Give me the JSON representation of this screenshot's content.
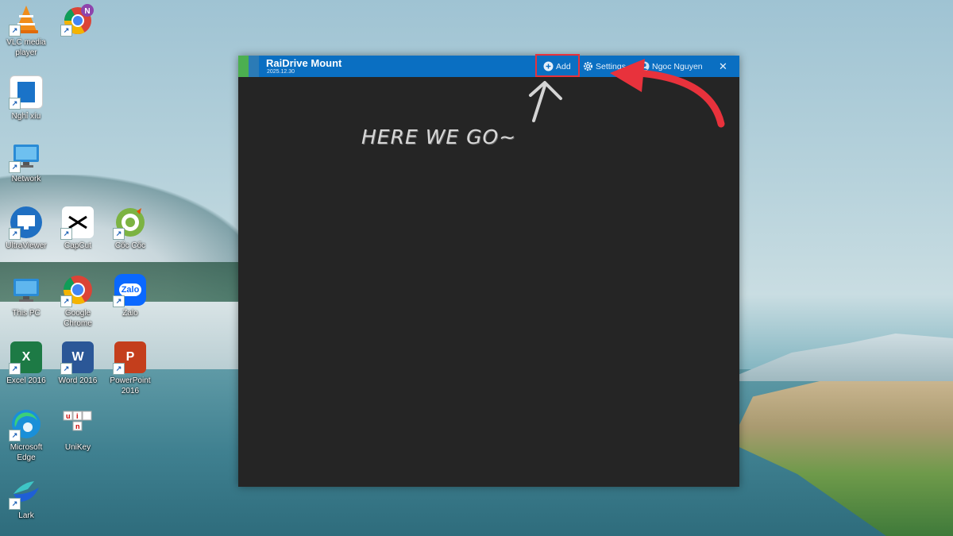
{
  "desktop": {
    "icons": [
      {
        "label": "VLC media\nplayer"
      },
      {
        "label": ""
      },
      {
        "label": "Nghỉ xíu"
      },
      {
        "label": "Network"
      },
      {
        "label": "UltraViewer"
      },
      {
        "label": "CapCut"
      },
      {
        "label": "Cốc Cốc"
      },
      {
        "label": "This PC"
      },
      {
        "label": "Google\nChrome"
      },
      {
        "label": "Zalo"
      },
      {
        "label": "Excel 2016"
      },
      {
        "label": "Word 2016"
      },
      {
        "label": "PowerPoint\n2016"
      },
      {
        "label": "Microsoft\nEdge"
      },
      {
        "label": "UniKey"
      },
      {
        "label": "Lark"
      }
    ]
  },
  "window": {
    "title": "RaiDrive Mount",
    "version": "2025.12.30",
    "add_label": "Add",
    "settings_label": "Settings",
    "user_label": "Ngoc Nguyen",
    "close_glyph": "✕"
  },
  "annotation": {
    "text": "HERE WE GO~",
    "arrow_color": "#e8323c",
    "highlight_color": "#e8323c"
  },
  "icons": {
    "add": "plus-circle-icon",
    "settings": "gear-icon",
    "user": "user-icon",
    "close": "close-icon"
  }
}
